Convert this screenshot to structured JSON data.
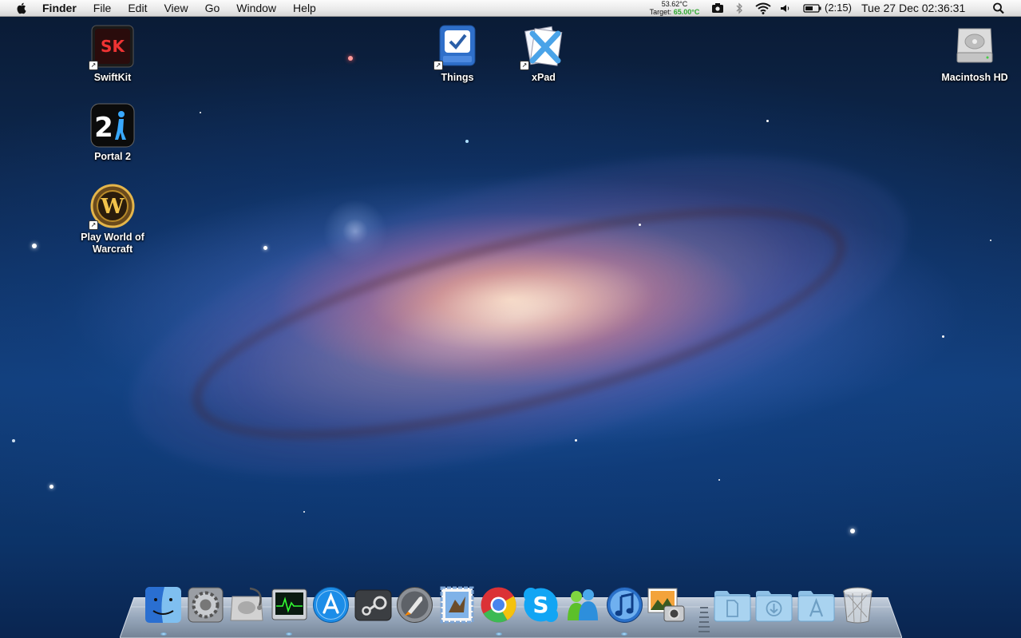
{
  "menubar": {
    "app_name": "Finder",
    "menus": [
      "File",
      "Edit",
      "View",
      "Go",
      "Window",
      "Help"
    ],
    "temperature": "53.62°C",
    "target_label": "Target:",
    "target_value": "65.00°C",
    "battery_time": "(2:15)",
    "datetime": "Tue 27 Dec  02:36:31"
  },
  "desktop": {
    "icons": [
      {
        "label": "SwiftKit",
        "icon": "swiftkit-icon"
      },
      {
        "label": "Portal 2",
        "icon": "portal2-icon"
      },
      {
        "label": "Play World of Warcraft",
        "icon": "warcraft-icon"
      },
      {
        "label": "Things",
        "icon": "things-icon"
      },
      {
        "label": "xPad",
        "icon": "xpad-icon"
      },
      {
        "label": "Macintosh HD",
        "icon": "hard-drive-icon"
      }
    ]
  },
  "dock": {
    "items": [
      {
        "icon": "finder-icon",
        "running": true
      },
      {
        "icon": "system-preferences-icon",
        "running": false
      },
      {
        "icon": "disk-utility-icon",
        "running": false
      },
      {
        "icon": "activity-monitor-icon",
        "running": true
      },
      {
        "icon": "app-store-icon",
        "running": false
      },
      {
        "icon": "steam-icon",
        "running": false
      },
      {
        "icon": "launchpad-icon",
        "running": false
      },
      {
        "icon": "mail-icon",
        "running": false
      },
      {
        "icon": "chrome-icon",
        "running": true
      },
      {
        "icon": "skype-icon",
        "running": false
      },
      {
        "icon": "messenger-icon",
        "running": false
      },
      {
        "icon": "itunes-icon",
        "running": true
      },
      {
        "icon": "iphoto-icon",
        "running": false
      },
      {
        "icon": "documents-folder-icon",
        "running": false
      },
      {
        "icon": "downloads-folder-icon",
        "running": false
      },
      {
        "icon": "applications-folder-icon",
        "running": false
      },
      {
        "icon": "trash-icon",
        "running": false
      }
    ]
  }
}
